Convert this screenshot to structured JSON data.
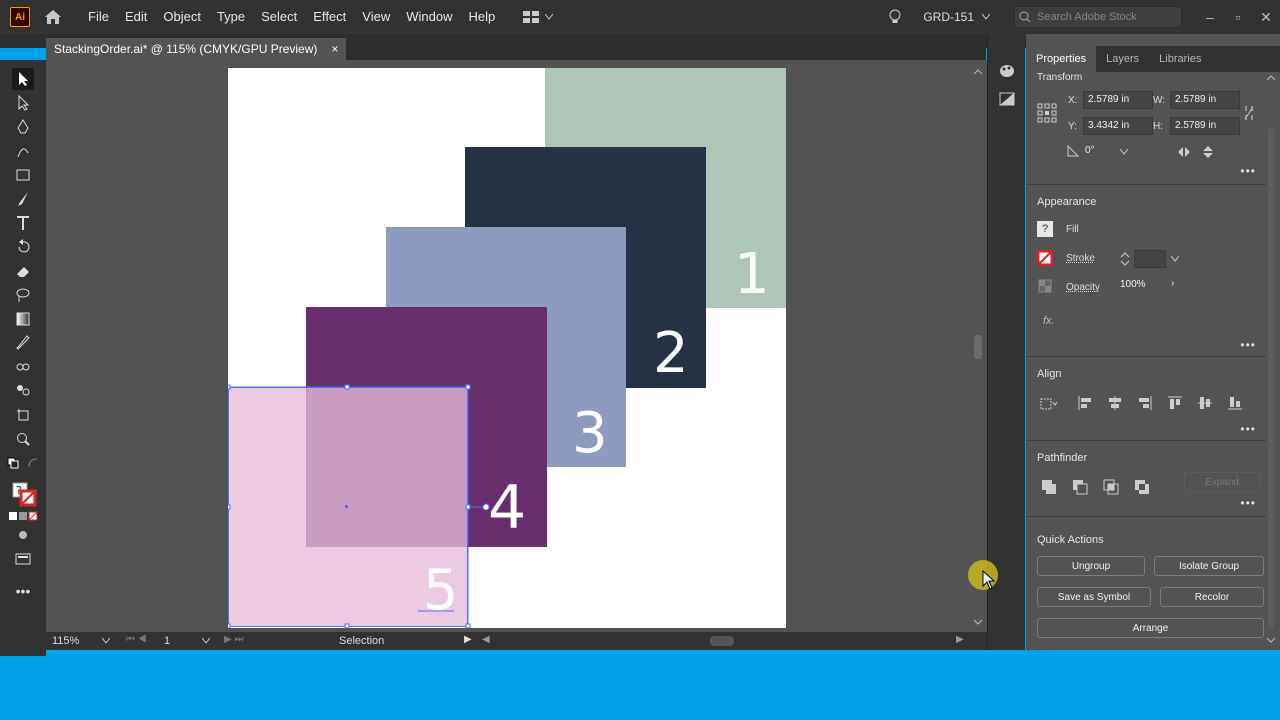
{
  "app": {
    "logo": "Ai"
  },
  "menu": [
    "File",
    "Edit",
    "Object",
    "Type",
    "Select",
    "Effect",
    "View",
    "Window",
    "Help"
  ],
  "workspace": "GRD-151",
  "search": {
    "placeholder": "Search Adobe Stock"
  },
  "document": {
    "tab_title": "StackingOrder.ai* @ 115% (CMYK/GPU Preview)",
    "close": "×"
  },
  "artwork": {
    "labels": [
      "1",
      "2",
      "3",
      "4",
      "5"
    ],
    "colors": {
      "sage": "#aec6b8",
      "navy": "#243243",
      "periwinkle": "#8c9bbe",
      "plum": "#682d6d",
      "pink": "#e7bbd8",
      "selection": "#4f70ff"
    }
  },
  "status": {
    "zoom": "115%",
    "artboard_num": "1",
    "tool": "Selection"
  },
  "panel": {
    "tabs": [
      "Properties",
      "Layers",
      "Libraries"
    ],
    "transform": {
      "title": "Transform",
      "x_label": "X:",
      "x": "2.5789 in",
      "y_label": "Y:",
      "y": "3.4342 in",
      "w_label": "W:",
      "w": "2.5789 in",
      "h_label": "H:",
      "h": "2.5789 in",
      "angle": "0°"
    },
    "appearance": {
      "title": "Appearance",
      "fill": "Fill",
      "stroke": "Stroke",
      "opacity": "Opacity",
      "opacity_value": "100%",
      "fx": "fx."
    },
    "align": {
      "title": "Align"
    },
    "pathfinder": {
      "title": "Pathfinder",
      "expand": "Expand"
    },
    "quick_actions": {
      "title": "Quick Actions",
      "ungroup": "Ungroup",
      "isolate": "Isolate Group",
      "save_symbol": "Save as Symbol",
      "recolor": "Recolor",
      "arrange": "Arrange"
    }
  }
}
